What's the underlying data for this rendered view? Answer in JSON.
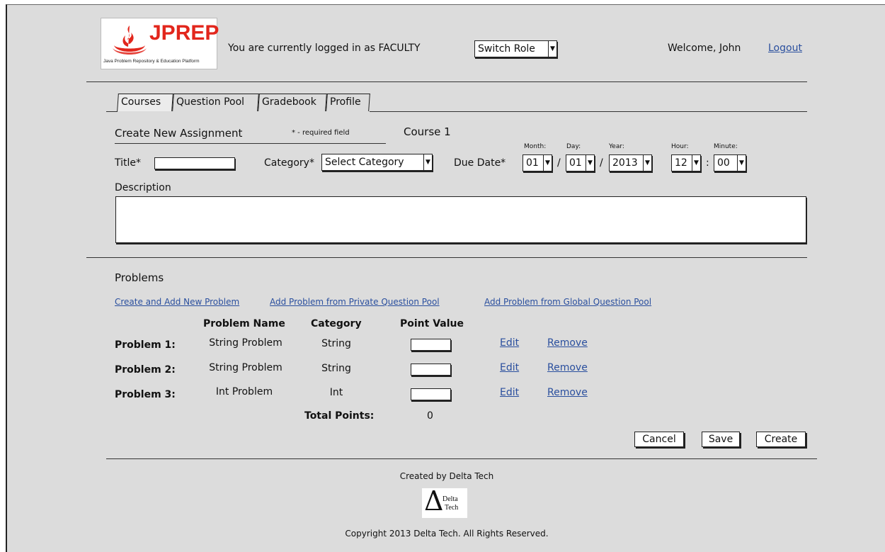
{
  "header": {
    "logo_text": "JPREP",
    "logo_subtitle": "Java Problem Repository & Education Platform",
    "login_status": "You are currently logged in as FACULTY",
    "switch_role_label": "Switch Role",
    "welcome": "Welcome, John",
    "logout": "Logout"
  },
  "tabs": [
    {
      "label": "Courses",
      "active": true
    },
    {
      "label": "Question Pool",
      "active": false
    },
    {
      "label": "Gradebook",
      "active": false
    },
    {
      "label": "Profile",
      "active": false
    }
  ],
  "form": {
    "heading": "Create New Assignment",
    "required_note": "* - required field",
    "course": "Course 1",
    "title_label": "Title*",
    "title_value": "",
    "category_label": "Category*",
    "category_value": "Select Category",
    "due_date_label": "Due Date*",
    "month_label": "Month:",
    "day_label": "Day:",
    "year_label": "Year:",
    "hour_label": "Hour:",
    "minute_label": "Minute:",
    "month_value": "01",
    "day_value": "01",
    "year_value": "2013",
    "hour_value": "12",
    "minute_value": "00",
    "date_sep": "/",
    "time_sep": ":",
    "description_label": "Description",
    "description_value": ""
  },
  "problems": {
    "heading": "Problems",
    "links": {
      "create_new": "Create and Add New Problem",
      "add_private": "Add Problem from Private Question Pool",
      "add_global": "Add Problem from Global Question Pool"
    },
    "columns": {
      "name": "Problem Name",
      "category": "Category",
      "points": "Point Value"
    },
    "rows": [
      {
        "label": "Problem 1:",
        "name": "String Problem",
        "category": "String",
        "points": "",
        "edit": "Edit",
        "remove": "Remove"
      },
      {
        "label": "Problem 2:",
        "name": "String Problem",
        "category": "String",
        "points": "",
        "edit": "Edit",
        "remove": "Remove"
      },
      {
        "label": "Problem 3:",
        "name": "Int Problem",
        "category": "Int",
        "points": "",
        "edit": "Edit",
        "remove": "Remove"
      }
    ],
    "total_label": "Total Points:",
    "total_value": "0"
  },
  "actions": {
    "cancel": "Cancel",
    "save": "Save",
    "create": "Create"
  },
  "footer": {
    "created_by": "Created by Delta Tech",
    "logo_delta": "Δ",
    "logo_line1": "Delta",
    "logo_line2": "Tech",
    "copyright": "Copyright 2013 Delta Tech. All Rights Reserved."
  },
  "colors": {
    "background": "#dcdcdc",
    "link": "#2a4f9e",
    "brand_red": "#e2261c"
  }
}
